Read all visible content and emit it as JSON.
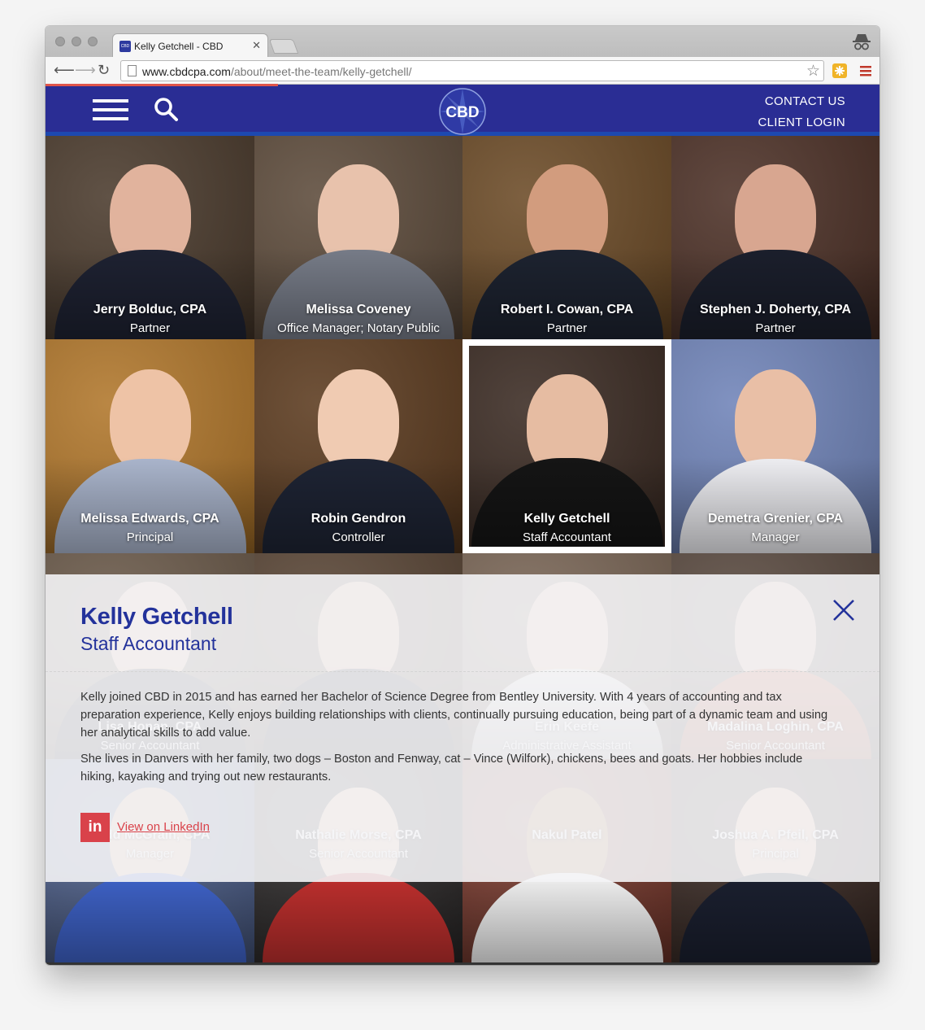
{
  "browser": {
    "tab_title": "Kelly Getchell - CBD",
    "favicon_text": "CBD",
    "url_host": "www.cbdcpa.com",
    "url_path": "/about/meet-the-team/kelly-getchell/"
  },
  "header": {
    "logo_text": "CBD",
    "links": [
      "CONTACT US",
      "CLIENT LOGIN"
    ],
    "colors": {
      "bar": "#2a2d94",
      "accent": "#1d49b0"
    }
  },
  "team": [
    {
      "name": "Jerry Bolduc, CPA",
      "role": "Partner"
    },
    {
      "name": "Melissa Coveney",
      "role": "Office Manager; Notary Public"
    },
    {
      "name": "Robert I. Cowan, CPA",
      "role": "Partner"
    },
    {
      "name": "Stephen J. Doherty, CPA",
      "role": "Partner"
    },
    {
      "name": "Melissa Edwards, CPA",
      "role": "Principal"
    },
    {
      "name": "Robin Gendron",
      "role": "Controller"
    },
    {
      "name": "Kelly Getchell",
      "role": "Staff Accountant"
    },
    {
      "name": "Demetra Grenier, CPA",
      "role": "Manager"
    },
    {
      "name": "Lisa Honan, CPA",
      "role": "Senior Accountant"
    },
    {
      "name": "",
      "role": ""
    },
    {
      "name": "Erin Keefe",
      "role": "Administrative Assistant"
    },
    {
      "name": "Madalina Loghin, CPA",
      "role": "Senior Accountant"
    },
    {
      "name": "Todd McGrain, CPA",
      "role": "Manager"
    },
    {
      "name": "Nathalie Morse, CPA",
      "role": "Senior Accountant"
    },
    {
      "name": "Nakul Patel",
      "role": ""
    },
    {
      "name": "Joshua A. Pfeil, CPA",
      "role": "Principal"
    }
  ],
  "detail": {
    "name": "Kelly Getchell",
    "title": "Staff Accountant",
    "bio": [
      "Kelly joined CBD in 2015 and has earned her Bachelor of Science Degree from Bentley University.  With 4 years of accounting and tax preparation experience, Kelly enjoys building relationships with clients, continually pursuing education, being part of a dynamic team and using her analytical skills to add value.",
      "She lives in Danvers with her family, two dogs – Boston and Fenway, cat – Vince (Wilfork), chickens, bees and goats.  Her hobbies include hiking, kayaking and trying out new restaurants."
    ],
    "linkedin_icon": "in",
    "linkedin_label": "View on LinkedIn"
  }
}
